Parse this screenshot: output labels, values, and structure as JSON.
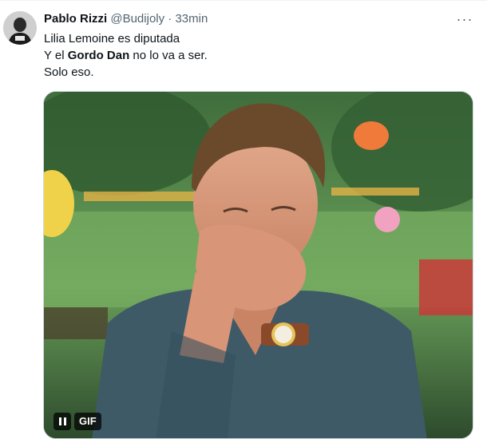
{
  "tweet": {
    "author_name": "Pablo Rizzi",
    "author_handle": "@Budijoly",
    "separator": "·",
    "timestamp": "33min",
    "more_icon": "more-horizontal-icon",
    "more_label": "···",
    "lines": {
      "line1": "Lilia Lemoine es diputada",
      "line2_prefix": "Y el ",
      "line2_bold": "Gordo Dan",
      "line2_suffix": " no lo va a ser.",
      "line3": "Solo eso."
    },
    "media": {
      "type": "gif",
      "badge_label": "GIF",
      "pause_icon": "pause-icon"
    }
  },
  "colors": {
    "text_primary": "#0f1419",
    "text_secondary": "#536471",
    "border": "#cfd9de"
  }
}
